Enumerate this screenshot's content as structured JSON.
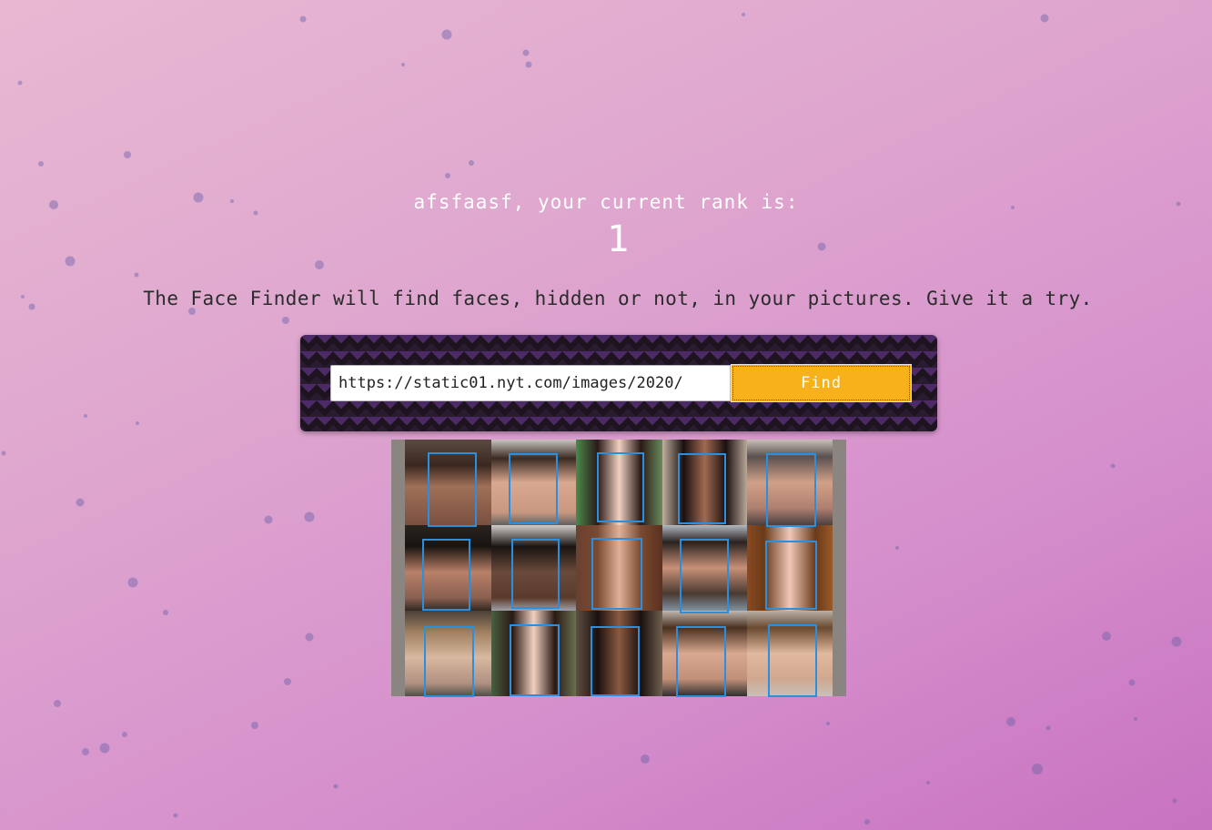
{
  "header": {
    "rank_label": "afsfaasf, your current rank is:",
    "rank_value": "1"
  },
  "tagline": "The Face Finder will find faces, hidden or not, in your pictures. Give it a try.",
  "search": {
    "url_value": "https://static01.nyt.com/images/2020/",
    "button_label": "Find"
  },
  "result": {
    "face_count": 15,
    "rows": 3,
    "columns": 5
  },
  "colors": {
    "accent_button": "#f8b11b",
    "face_box": "#2b8fe0",
    "panel_dark": "#1e1420",
    "panel_chevron": "#4b2a66"
  }
}
